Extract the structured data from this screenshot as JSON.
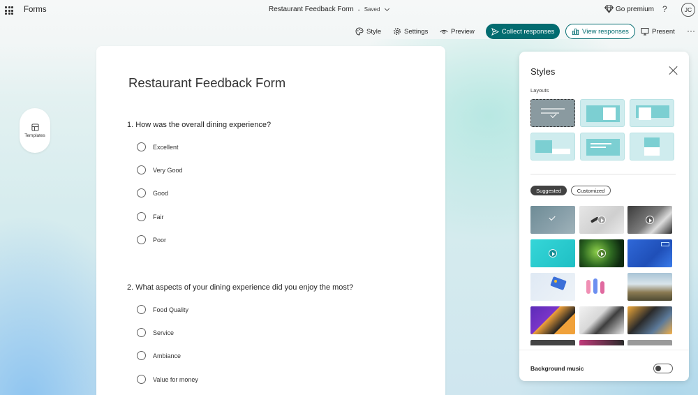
{
  "app": {
    "name": "Forms"
  },
  "header": {
    "doc_title": "Restaurant Feedback Form",
    "separator": "-",
    "save_status": "Saved",
    "premium_label": "Go premium",
    "help_label": "?",
    "avatar_initials": "JC"
  },
  "toolbar": {
    "style_label": "Style",
    "settings_label": "Settings",
    "preview_label": "Preview",
    "collect_label": "Collect responses",
    "view_label": "View responses",
    "present_label": "Present",
    "more_label": "···"
  },
  "sidebar": {
    "templates_label": "Templates"
  },
  "form": {
    "title": "Restaurant Feedback Form",
    "questions": [
      {
        "text": "1. How was the overall dining experience?",
        "options": [
          "Excellent",
          "Very Good",
          "Good",
          "Fair",
          "Poor"
        ]
      },
      {
        "text": "2. What aspects of your dining experience did you enjoy the most?",
        "options": [
          "Food Quality",
          "Service",
          "Ambiance",
          "Value for money"
        ]
      }
    ]
  },
  "styles_panel": {
    "title": "Styles",
    "layouts_label": "Layouts",
    "tabs": {
      "suggested": "Suggested",
      "customized": "Customized"
    },
    "background_music_label": "Background music",
    "background_music_on": false
  },
  "colors": {
    "accent": "#036c70",
    "layout_tile": "#cfecee",
    "layout_block": "#7ccfd2"
  }
}
